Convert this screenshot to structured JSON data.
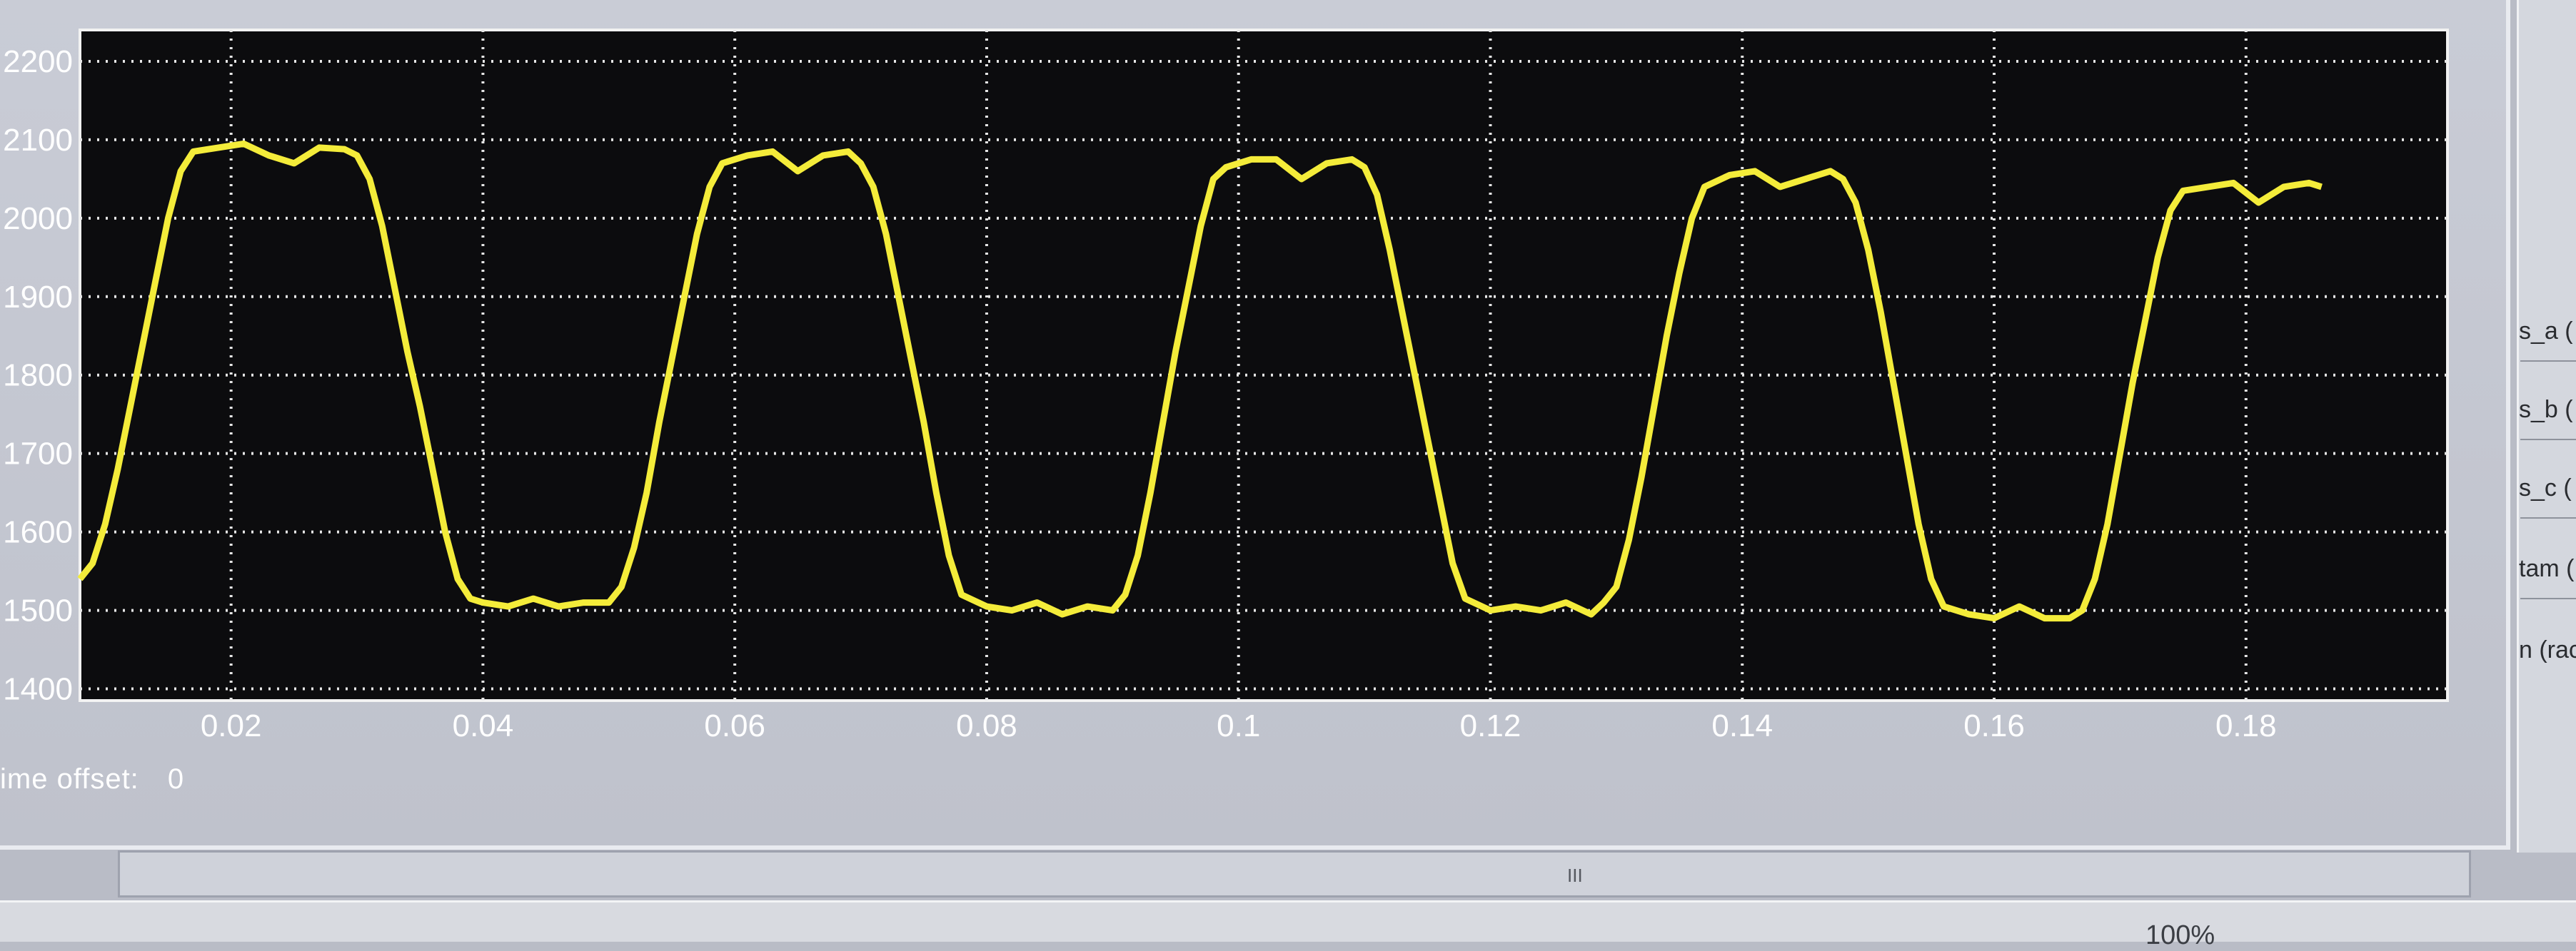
{
  "chart_data": {
    "type": "line",
    "xlim": [
      0.008,
      0.196
    ],
    "ylim": [
      1385,
      2240
    ],
    "x_ticks": [
      "0.02",
      "0.04",
      "0.06",
      "0.08",
      "0.1",
      "0.12",
      "0.14",
      "0.16",
      "0.18"
    ],
    "y_ticks": [
      "1400",
      "1500",
      "1600",
      "1700",
      "1800",
      "1900",
      "2000",
      "2100",
      "2200"
    ],
    "grid": true,
    "series": [
      {
        "color": "#f4ec3a",
        "points": [
          [
            0.008,
            1540
          ],
          [
            0.009,
            1560
          ],
          [
            0.01,
            1610
          ],
          [
            0.011,
            1680
          ],
          [
            0.012,
            1760
          ],
          [
            0.013,
            1840
          ],
          [
            0.014,
            1920
          ],
          [
            0.015,
            2000
          ],
          [
            0.016,
            2060
          ],
          [
            0.017,
            2085
          ],
          [
            0.019,
            2090
          ],
          [
            0.021,
            2095
          ],
          [
            0.023,
            2080
          ],
          [
            0.025,
            2070
          ],
          [
            0.027,
            2090
          ],
          [
            0.029,
            2088
          ],
          [
            0.03,
            2080
          ],
          [
            0.031,
            2050
          ],
          [
            0.032,
            1990
          ],
          [
            0.033,
            1910
          ],
          [
            0.034,
            1830
          ],
          [
            0.035,
            1760
          ],
          [
            0.036,
            1680
          ],
          [
            0.037,
            1600
          ],
          [
            0.038,
            1540
          ],
          [
            0.039,
            1515
          ],
          [
            0.04,
            1510
          ],
          [
            0.042,
            1505
          ],
          [
            0.044,
            1515
          ],
          [
            0.046,
            1505
          ],
          [
            0.048,
            1510
          ],
          [
            0.05,
            1510
          ],
          [
            0.051,
            1530
          ],
          [
            0.052,
            1580
          ],
          [
            0.053,
            1650
          ],
          [
            0.054,
            1740
          ],
          [
            0.055,
            1820
          ],
          [
            0.056,
            1900
          ],
          [
            0.057,
            1980
          ],
          [
            0.058,
            2040
          ],
          [
            0.059,
            2070
          ],
          [
            0.061,
            2080
          ],
          [
            0.063,
            2085
          ],
          [
            0.065,
            2060
          ],
          [
            0.067,
            2080
          ],
          [
            0.069,
            2085
          ],
          [
            0.07,
            2070
          ],
          [
            0.071,
            2040
          ],
          [
            0.072,
            1980
          ],
          [
            0.073,
            1900
          ],
          [
            0.074,
            1820
          ],
          [
            0.075,
            1740
          ],
          [
            0.076,
            1650
          ],
          [
            0.077,
            1570
          ],
          [
            0.078,
            1520
          ],
          [
            0.08,
            1505
          ],
          [
            0.082,
            1500
          ],
          [
            0.084,
            1510
          ],
          [
            0.086,
            1495
          ],
          [
            0.088,
            1505
          ],
          [
            0.09,
            1500
          ],
          [
            0.091,
            1520
          ],
          [
            0.092,
            1570
          ],
          [
            0.093,
            1650
          ],
          [
            0.094,
            1740
          ],
          [
            0.095,
            1830
          ],
          [
            0.096,
            1910
          ],
          [
            0.097,
            1990
          ],
          [
            0.098,
            2050
          ],
          [
            0.099,
            2065
          ],
          [
            0.101,
            2075
          ],
          [
            0.103,
            2075
          ],
          [
            0.105,
            2050
          ],
          [
            0.107,
            2070
          ],
          [
            0.109,
            2075
          ],
          [
            0.11,
            2065
          ],
          [
            0.111,
            2030
          ],
          [
            0.112,
            1960
          ],
          [
            0.113,
            1880
          ],
          [
            0.114,
            1800
          ],
          [
            0.115,
            1720
          ],
          [
            0.116,
            1640
          ],
          [
            0.117,
            1560
          ],
          [
            0.118,
            1515
          ],
          [
            0.12,
            1500
          ],
          [
            0.122,
            1505
          ],
          [
            0.124,
            1500
          ],
          [
            0.126,
            1510
          ],
          [
            0.128,
            1495
          ],
          [
            0.129,
            1510
          ],
          [
            0.13,
            1530
          ],
          [
            0.131,
            1590
          ],
          [
            0.132,
            1670
          ],
          [
            0.133,
            1760
          ],
          [
            0.134,
            1850
          ],
          [
            0.135,
            1930
          ],
          [
            0.136,
            2000
          ],
          [
            0.137,
            2040
          ],
          [
            0.139,
            2055
          ],
          [
            0.141,
            2060
          ],
          [
            0.143,
            2040
          ],
          [
            0.145,
            2050
          ],
          [
            0.147,
            2060
          ],
          [
            0.148,
            2050
          ],
          [
            0.149,
            2020
          ],
          [
            0.15,
            1960
          ],
          [
            0.151,
            1880
          ],
          [
            0.152,
            1790
          ],
          [
            0.153,
            1700
          ],
          [
            0.154,
            1610
          ],
          [
            0.155,
            1540
          ],
          [
            0.156,
            1505
          ],
          [
            0.158,
            1495
          ],
          [
            0.16,
            1490
          ],
          [
            0.162,
            1505
          ],
          [
            0.164,
            1490
          ],
          [
            0.166,
            1490
          ],
          [
            0.167,
            1500
          ],
          [
            0.168,
            1540
          ],
          [
            0.169,
            1610
          ],
          [
            0.17,
            1700
          ],
          [
            0.171,
            1790
          ],
          [
            0.172,
            1870
          ],
          [
            0.173,
            1950
          ],
          [
            0.174,
            2010
          ],
          [
            0.175,
            2035
          ],
          [
            0.177,
            2040
          ],
          [
            0.179,
            2045
          ],
          [
            0.181,
            2020
          ],
          [
            0.183,
            2040
          ],
          [
            0.185,
            2045
          ],
          [
            0.186,
            2040
          ]
        ]
      }
    ]
  },
  "time_offset": {
    "label": "ime offset:",
    "value": "0"
  },
  "right_panel": {
    "labels": [
      "s_a (",
      "s_b (",
      "s_c (",
      "tam (",
      "n (rac"
    ]
  },
  "status_bar": {
    "zoom": "100%"
  },
  "scrollbar": {
    "grip": "III"
  }
}
